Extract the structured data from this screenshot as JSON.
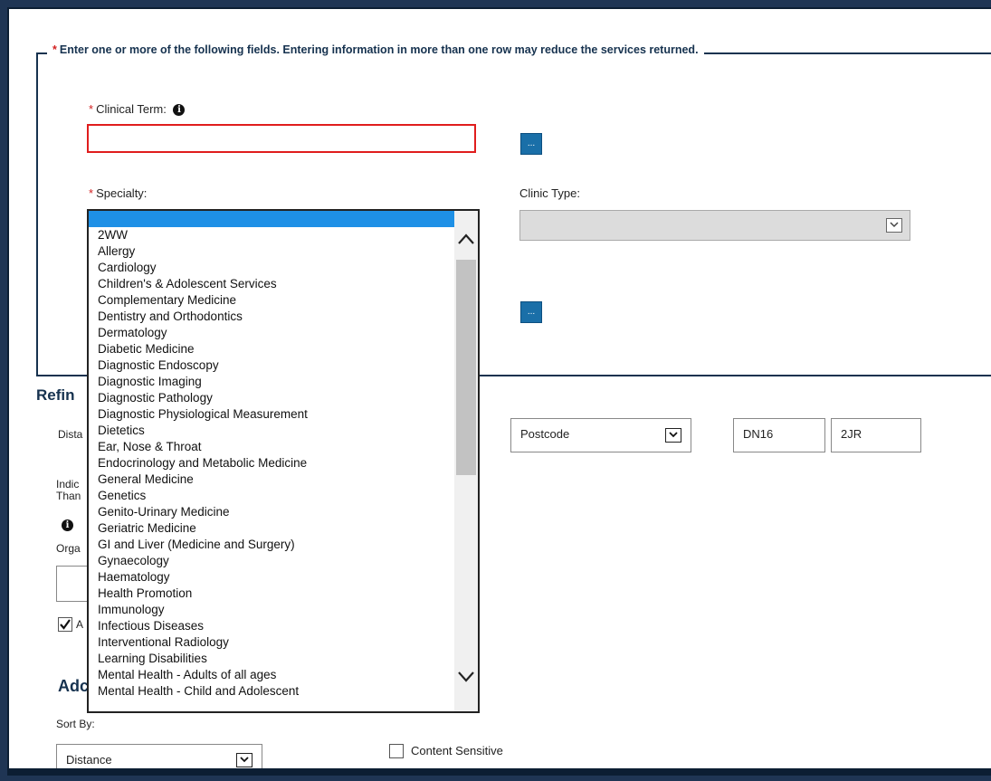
{
  "form": {
    "required_mark": "*",
    "legend": "Enter one or more of the following fields. Entering information in more than one row may reduce the services returned.",
    "clinical_term_label": "Clinical Term:",
    "info_glyph": "i",
    "clinical_term_value": "",
    "lookup_button_label": "...",
    "specialty_label": "Specialty:",
    "clinic_type_label": "Clinic Type:",
    "clinic_type_value": ""
  },
  "refine": {
    "heading_partial": "Refin",
    "distance_label_partial": "Dista",
    "indicate_label_partial_1": "Indic",
    "indicate_label_partial_2": "Than",
    "org_label_partial": "Orga",
    "checkbox_label_partial": "A",
    "location_type_value": "Postcode",
    "postcode_part1": "DN16",
    "postcode_part2": "2JR"
  },
  "additional": {
    "heading_partial": "Adc",
    "sort_by_label": "Sort By:",
    "sort_by_value": "Distance",
    "content_sensitive_label": "Content Sensitive"
  },
  "specialty_dropdown": {
    "selected_index": 0,
    "options": [
      "",
      "2WW",
      "Allergy",
      "Cardiology",
      "Children's & Adolescent Services",
      "Complementary Medicine",
      "Dentistry and Orthodontics",
      "Dermatology",
      "Diabetic Medicine",
      "Diagnostic Endoscopy",
      "Diagnostic Imaging",
      "Diagnostic Pathology",
      "Diagnostic Physiological Measurement",
      "Dietetics",
      "Ear, Nose & Throat",
      "Endocrinology and Metabolic Medicine",
      "General Medicine",
      "Genetics",
      "Genito-Urinary Medicine",
      "Geriatric Medicine",
      "GI and Liver (Medicine and Surgery)",
      "Gynaecology",
      "Haematology",
      "Health Promotion",
      "Immunology",
      "Infectious Diseases",
      "Interventional Radiology",
      "Learning Disabilities",
      "Mental Health - Adults of all ages",
      "Mental Health - Child and Adolescent"
    ]
  },
  "colors": {
    "required": "#d21f1f",
    "heading": "#16324f",
    "button": "#1a6fa8",
    "selection": "#1e90e6",
    "frame": "#1f3554"
  }
}
